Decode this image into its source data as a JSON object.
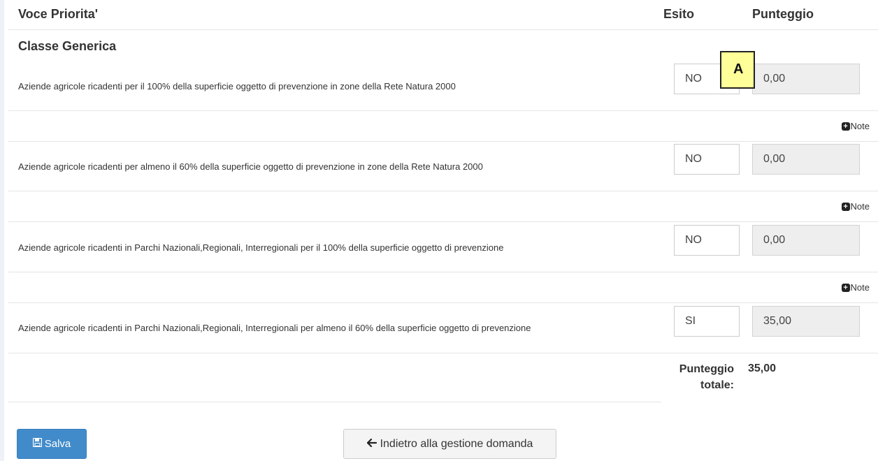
{
  "table": {
    "headers": {
      "voce": "Voce Priorita'",
      "esito": "Esito",
      "punteggio": "Punteggio"
    },
    "section_title": "Classe Generica",
    "rows": [
      {
        "label": "Aziende agricole ricadenti per il 100% della superficie oggetto di prevenzione in zone della Rete Natura 2000",
        "esito": "NO",
        "punteggio": "0,00",
        "note_label": "Note"
      },
      {
        "label": "Aziende agricole ricadenti per almeno il 60% della superficie oggetto di prevenzione in zone della Rete Natura 2000",
        "esito": "NO",
        "punteggio": "0,00",
        "note_label": "Note"
      },
      {
        "label": "Aziende agricole ricadenti in Parchi Nazionali,Regionali, Interregionali per il 100% della superficie oggetto di prevenzione",
        "esito": "NO",
        "punteggio": "0,00",
        "note_label": "Note"
      },
      {
        "label": "Aziende agricole ricadenti in Parchi Nazionali,Regionali, Interregionali per almeno il 60% della superficie oggetto di prevenzione",
        "esito": "SI",
        "punteggio": "35,00"
      }
    ],
    "total": {
      "label_line1": "Punteggio",
      "label_line2": "totale:",
      "value": "35,00"
    }
  },
  "annotation": {
    "marker": "A"
  },
  "buttons": {
    "save_label": "Salva",
    "back_label": "Indietro alla gestione domanda"
  },
  "icons": {
    "save": "floppy-disk-icon",
    "back": "arrow-left-icon",
    "note": "plus-square-icon"
  },
  "colors": {
    "primary": "#428bca",
    "marker": "#ffff99"
  }
}
